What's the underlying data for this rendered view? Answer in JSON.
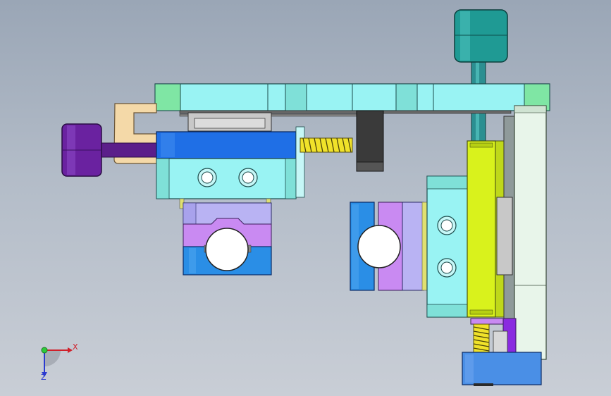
{
  "viewport": {
    "background_top": "#9aa6b6",
    "background_bottom": "#c9ced6"
  },
  "triad": {
    "x_label": "X",
    "z_label": "Z",
    "x_color": "#d0202a",
    "z_color": "#2a3ad0",
    "origin_color": "#2ec93a"
  },
  "colors": {
    "cyan_plate": "#99f3f3",
    "green_end": "#7fe6a4",
    "blue_block": "#1f6fe6",
    "teal_knob": "#1f9a94",
    "purple_knob": "#6a22a0",
    "yellow_green_plate": "#d9f21c",
    "violet_part": "#c98af2",
    "lavender_part": "#b9b3f3",
    "spring_yellow": "#f0e22a",
    "dark_gray": "#3a3a3a",
    "peach_bracket": "#f4d9a8"
  }
}
